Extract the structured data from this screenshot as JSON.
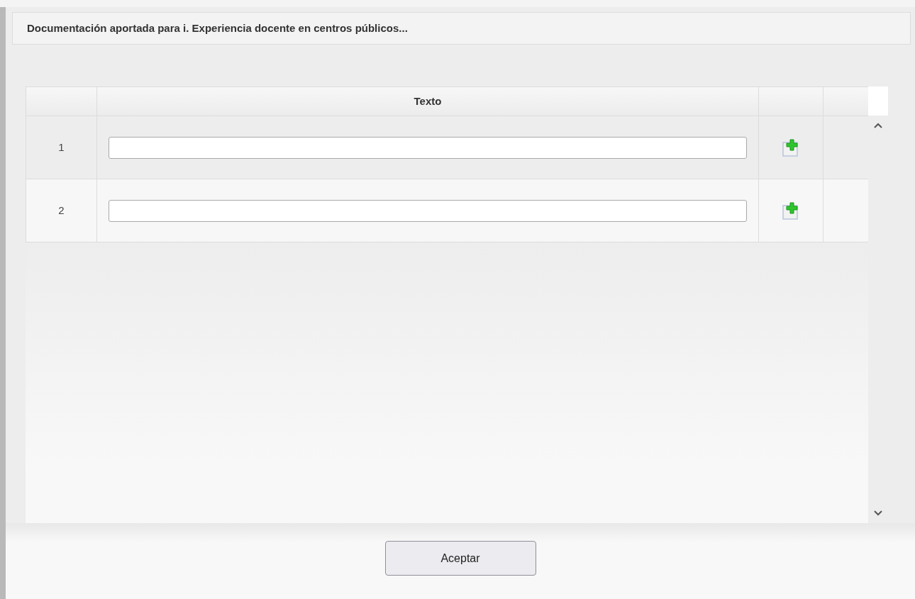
{
  "dialog": {
    "title": "Documentación aportada para i. Experiencia docente en centros públicos..."
  },
  "table": {
    "columns": [
      "",
      "Texto",
      "",
      ""
    ],
    "rows": [
      {
        "number": "1",
        "value": ""
      },
      {
        "number": "2",
        "value": ""
      }
    ]
  },
  "buttons": [
    {
      "label": "Aceptar"
    }
  ]
}
